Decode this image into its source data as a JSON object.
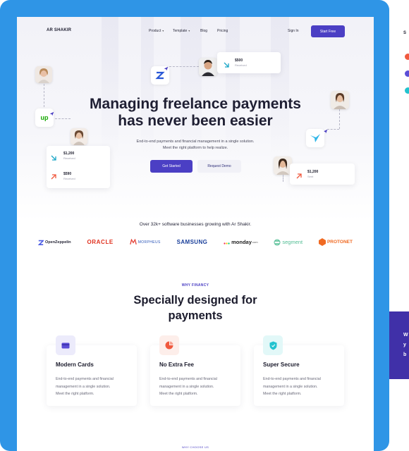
{
  "brand": {
    "name": "AR SHAKIR"
  },
  "nav": {
    "items": [
      {
        "label": "Product",
        "has_dropdown": true
      },
      {
        "label": "Template",
        "has_dropdown": true
      },
      {
        "label": "Blog",
        "has_dropdown": false
      },
      {
        "label": "Pricing",
        "has_dropdown": false
      }
    ],
    "signin": "Sign In",
    "cta": "Start Free"
  },
  "hero": {
    "title_line1": "Managing freelance payments",
    "title_line2": "has never been easier",
    "subtitle": "End-to-end payments and financial management in a single solution. Meet the right platform to help realize.",
    "primary_cta": "Get Started",
    "secondary_cta": "Request Demo"
  },
  "floating": {
    "received_card": {
      "amount": "$500",
      "label": "Received"
    },
    "left_card": [
      {
        "amount": "$1,200",
        "label": "Received"
      },
      {
        "amount": "$590",
        "label": "Received"
      }
    ],
    "sent_card": {
      "amount": "$1,200",
      "label": "Sent"
    },
    "upwork_text": "up"
  },
  "trusted": {
    "heading": "Over 32k+ software businesses growing with Ar Shakir.",
    "logos": [
      {
        "name": "OpenZeppelin",
        "icon": "openzeppelin-icon"
      },
      {
        "name": "ORACLE",
        "icon": "oracle-logo"
      },
      {
        "name": "MORPHEUS",
        "icon": "morpheus-icon"
      },
      {
        "name": "SAMSUNG",
        "icon": "samsung-logo"
      },
      {
        "name": "monday",
        "suffix": ".com",
        "icon": "monday-icon"
      },
      {
        "name": "segment",
        "icon": "segment-icon"
      },
      {
        "name": "PROTONET",
        "icon": "protonet-icon"
      }
    ]
  },
  "features": {
    "eyebrow": "WHY FINANCY",
    "title_line1": "Specially designed for",
    "title_line2": "payments",
    "cards": [
      {
        "title": "Modern Cards",
        "icon": "credit-card-icon",
        "line1": "End-to-end payments and financial",
        "line2": "management in a single solution.",
        "line3": "Meet the right platform."
      },
      {
        "title": "No Extra Fee",
        "icon": "pie-chart-icon",
        "line1": "End-to-end payments and financial",
        "line2": "management in a single solution.",
        "line3": "Meet the right platform."
      },
      {
        "title": "Super Secure",
        "icon": "shield-icon",
        "line1": "End-to-end payments and financial",
        "line2": "management in a single solution.",
        "line3": "Meet the right platform."
      }
    ]
  },
  "next_section_eyebrow": "WHY CHOOSE US",
  "colors": {
    "frame_blue": "#2f95e6",
    "primary": "#4b3fc4",
    "heading": "#1f1f33",
    "received_arrow": "#1aa6c7",
    "sent_arrow": "#f0593e",
    "upwork_green": "#14a800"
  }
}
